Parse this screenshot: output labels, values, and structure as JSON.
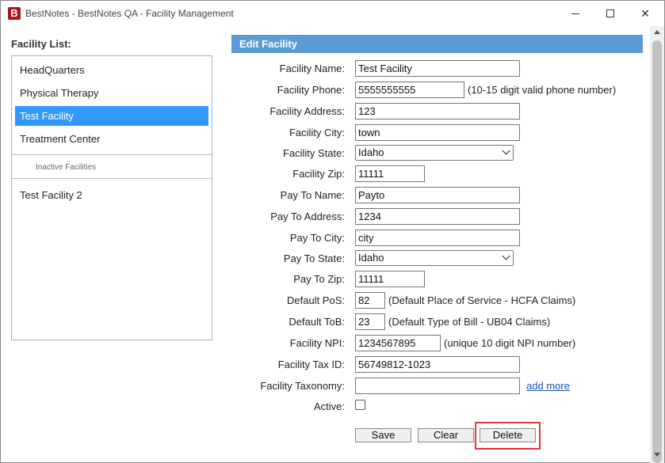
{
  "window": {
    "app_icon_letter": "B",
    "title": "BestNotes - BestNotes QA - Facility Management",
    "close_glyph": "✕"
  },
  "facility_list": {
    "label": "Facility List:",
    "active_items": [
      "HeadQuarters",
      "Physical Therapy",
      "Test Facility",
      "Treatment Center"
    ],
    "selected": "Test Facility",
    "inactive_label": "Inactive Facilities",
    "inactive_items": [
      "Test Facility 2"
    ]
  },
  "edit": {
    "header": "Edit Facility",
    "fields": {
      "facility_name": {
        "label": "Facility Name:",
        "value": "Test Facility"
      },
      "facility_phone": {
        "label": "Facility Phone:",
        "value": "5555555555",
        "hint": "(10-15 digit valid phone number)"
      },
      "facility_address": {
        "label": "Facility Address:",
        "value": "123"
      },
      "facility_city": {
        "label": "Facility City:",
        "value": "town"
      },
      "facility_state": {
        "label": "Facility State:",
        "value": "Idaho"
      },
      "facility_zip": {
        "label": "Facility Zip:",
        "value": "11111"
      },
      "pay_to_name": {
        "label": "Pay To Name:",
        "value": "Payto"
      },
      "pay_to_address": {
        "label": "Pay To Address:",
        "value": "1234"
      },
      "pay_to_city": {
        "label": "Pay To City:",
        "value": "city"
      },
      "pay_to_state": {
        "label": "Pay To State:",
        "value": "Idaho"
      },
      "pay_to_zip": {
        "label": "Pay To Zip:",
        "value": "11111"
      },
      "default_pos": {
        "label": "Default PoS:",
        "value": "82",
        "hint": "(Default Place of Service - HCFA Claims)"
      },
      "default_tob": {
        "label": "Default ToB:",
        "value": "23",
        "hint": "(Default Type of Bill - UB04 Claims)"
      },
      "facility_npi": {
        "label": "Facility NPI:",
        "value": "1234567895",
        "hint": "(unique 10 digit NPI number)"
      },
      "facility_tax_id": {
        "label": "Facility Tax ID:",
        "value": "56749812-1023"
      },
      "facility_taxonomy": {
        "label": "Facility Taxonomy:",
        "value": "",
        "link": "add more"
      },
      "active": {
        "label": "Active:",
        "checked": false
      }
    },
    "buttons": {
      "save": "Save",
      "clear": "Clear",
      "delete": "Delete"
    }
  },
  "colors": {
    "header_bg": "#5b9bd5",
    "selected_bg": "#3399ff",
    "highlight": "#e0383e",
    "link": "#1a55b5"
  }
}
